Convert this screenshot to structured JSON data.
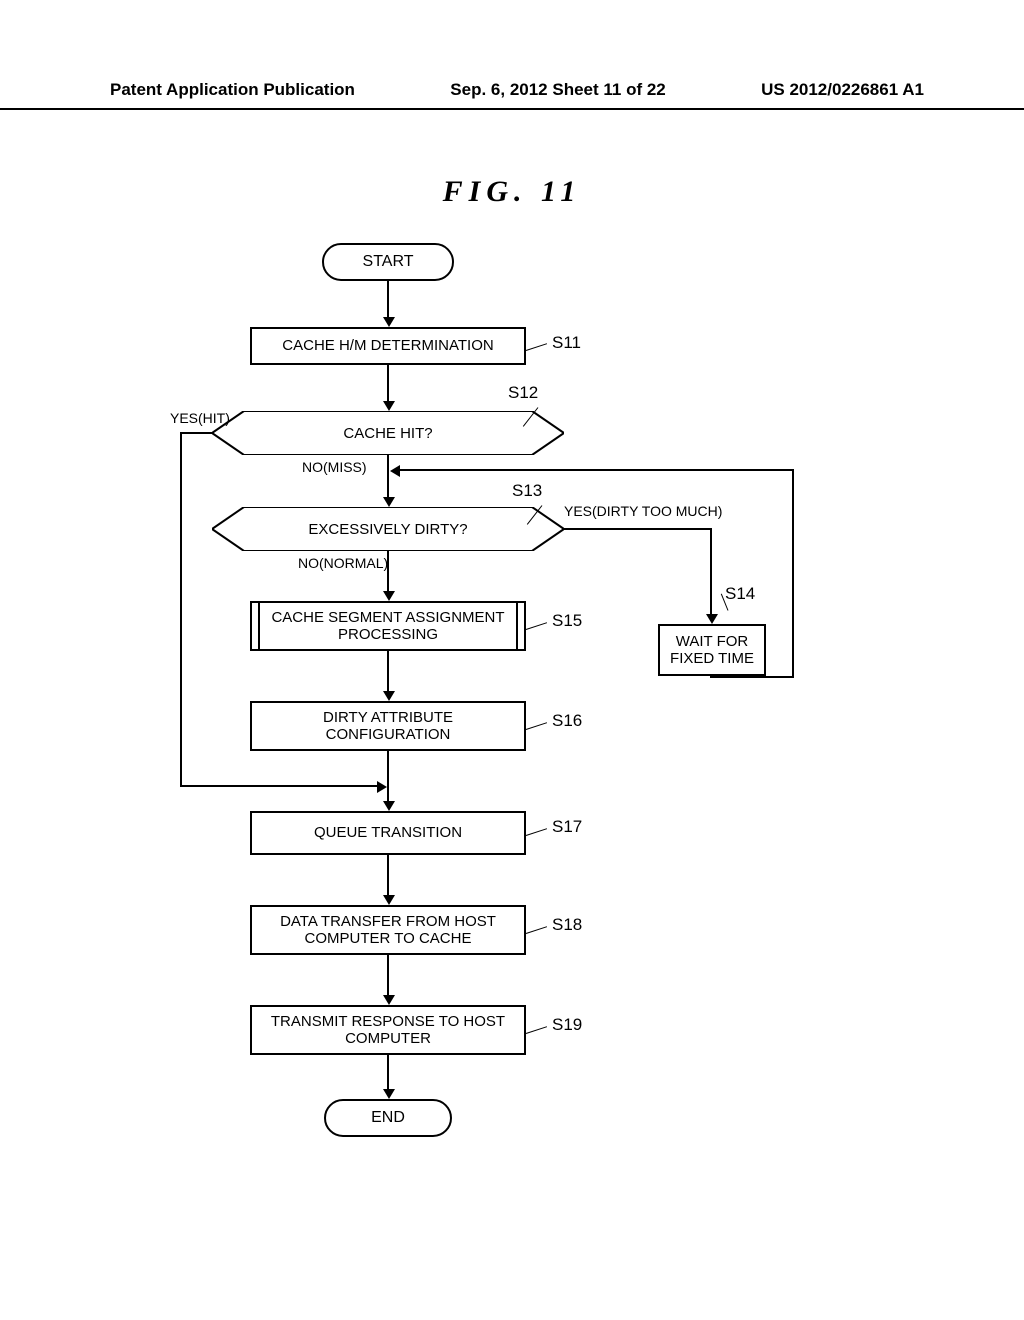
{
  "header": {
    "left": "Patent Application Publication",
    "center": "Sep. 6, 2012  Sheet 11 of 22",
    "right": "US 2012/0226861 A1"
  },
  "figure_title": "FIG. 11",
  "boxes": {
    "start": "START",
    "s11": "CACHE H/M DETERMINATION",
    "s12": "CACHE HIT?",
    "s13": "EXCESSIVELY DIRTY?",
    "s14": "WAIT FOR FIXED TIME",
    "s15": "CACHE SEGMENT ASSIGNMENT PROCESSING",
    "s16": "DIRTY ATTRIBUTE CONFIGURATION",
    "s17": "QUEUE TRANSITION",
    "s18": "DATA TRANSFER FROM HOST COMPUTER TO CACHE",
    "s19": "TRANSMIT RESPONSE TO HOST COMPUTER",
    "end": "END"
  },
  "step_ids": {
    "s11": "S11",
    "s12": "S12",
    "s13": "S13",
    "s14": "S14",
    "s15": "S15",
    "s16": "S16",
    "s17": "S17",
    "s18": "S18",
    "s19": "S19"
  },
  "branches": {
    "s12_yes": "YES(HIT)",
    "s12_no": "NO(MISS)",
    "s13_yes": "YES(DIRTY TOO MUCH)",
    "s13_no": "NO(NORMAL)"
  }
}
